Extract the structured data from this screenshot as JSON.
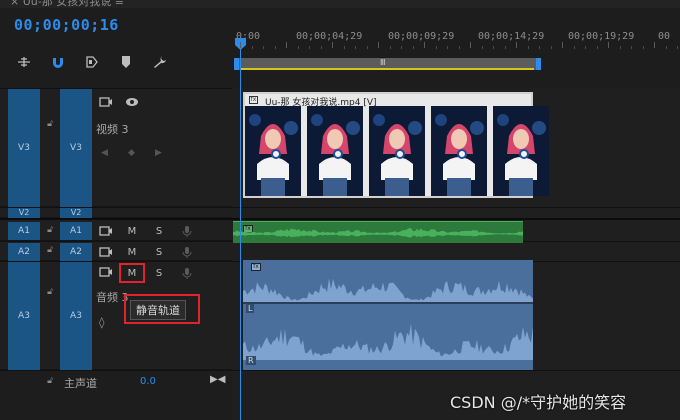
{
  "panel": {
    "title_fragment": "× Uu-那 女孩对我说 ≡"
  },
  "timecode": "00;00;00;16",
  "ruler": {
    "labels": [
      "0;00",
      "00;00;04;29",
      "00;00;09;29",
      "00;00;14;29",
      "00;00;19;29",
      "00"
    ]
  },
  "workbar_handle": "Ⅲ",
  "tracks": {
    "v3": {
      "src": "V3",
      "tgt": "V3",
      "name": "视频 3"
    },
    "v2": {
      "src": "V2",
      "tgt": "V2"
    },
    "a1": {
      "src": "A1",
      "tgt": "A1",
      "m": "M",
      "s": "S"
    },
    "a2": {
      "src": "A2",
      "tgt": "A2",
      "m": "M",
      "s": "S"
    },
    "a3": {
      "src": "A3",
      "tgt": "A3",
      "m": "M",
      "s": "S",
      "name": "音频 3"
    }
  },
  "video_clip": {
    "name": "Uu-那 女孩对我说.mp4 [V]",
    "frames": 5
  },
  "audio_clip": {
    "a1_fx": "fx",
    "a3_fx": "fx",
    "channels": [
      "L",
      "R"
    ]
  },
  "tooltip": "静音轨道",
  "master": {
    "label": "主声道",
    "value": "0.0"
  },
  "watermark": "CSDN @/*守护她的笑容",
  "colors": {
    "accent": "#2d8ceb",
    "track_blue": "#1b5586",
    "audio_green": "#2d7a3d",
    "audio_blue": "#4a6f9c",
    "highlight_red": "#e0242b"
  }
}
